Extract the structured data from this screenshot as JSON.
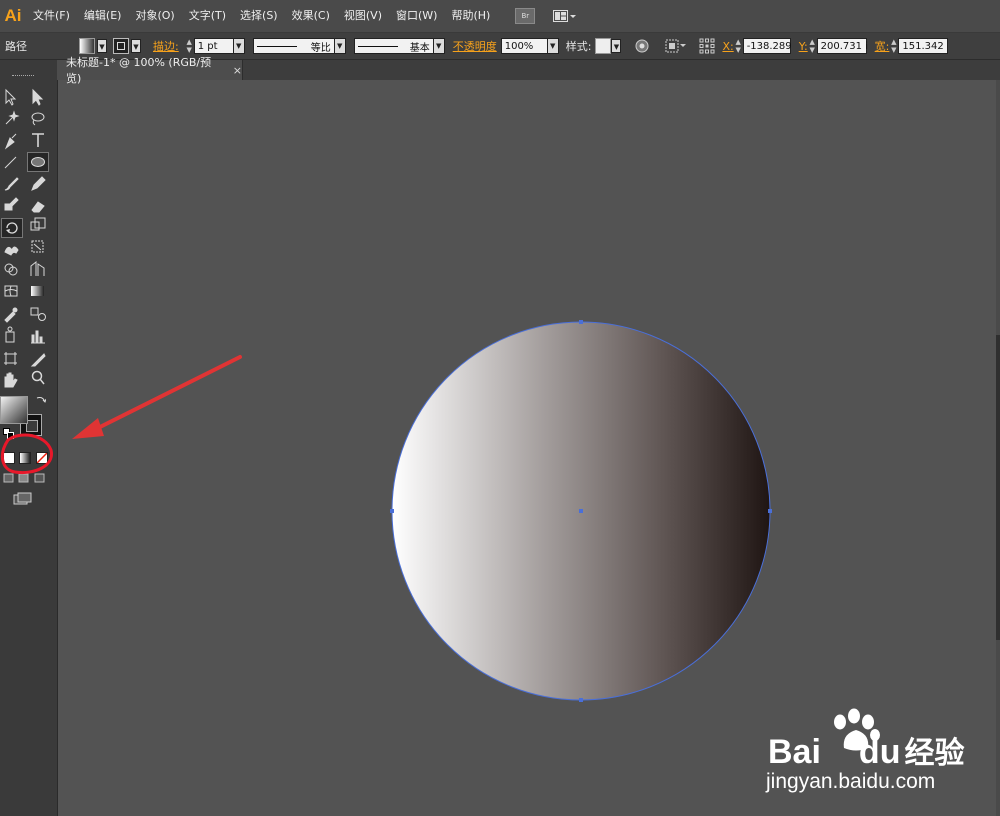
{
  "app": {
    "logo": "Ai"
  },
  "menu": {
    "items": [
      {
        "label": "文件(F)"
      },
      {
        "label": "编辑(E)"
      },
      {
        "label": "对象(O)"
      },
      {
        "label": "文字(T)"
      },
      {
        "label": "选择(S)"
      },
      {
        "label": "效果(C)"
      },
      {
        "label": "视图(V)"
      },
      {
        "label": "窗口(W)"
      },
      {
        "label": "帮助(H)"
      }
    ],
    "bridge_icon": "Br"
  },
  "control": {
    "selection_type": "路径",
    "stroke_label": "描边:",
    "stroke_weight": "1 pt",
    "profile_label": "等比",
    "brush_label": "基本",
    "opacity_label": "不透明度",
    "opacity_value": "100%",
    "style_label": "样式:",
    "x_label": "X:",
    "x_value": "-138.289",
    "y_label": "Y:",
    "y_value": "200.731 i",
    "w_label": "宽:",
    "w_value": "151.342"
  },
  "document": {
    "tab_title": "未标题-1* @ 100% (RGB/预览)",
    "close": "×"
  },
  "artwork": {
    "gradient_start": "#ffffff",
    "gradient_mid": "#a49e9d",
    "gradient_dark": "#5f5553",
    "gradient_end": "#1f1513",
    "selection_color": "#4a6fd8"
  },
  "annotation": {
    "arrow_color": "#e03434",
    "circle_color": "#e8182a"
  },
  "watermark": {
    "brand": "Bai",
    "brand2": "du",
    "chinese": "经验",
    "url": "jingyan.baidu.com"
  }
}
